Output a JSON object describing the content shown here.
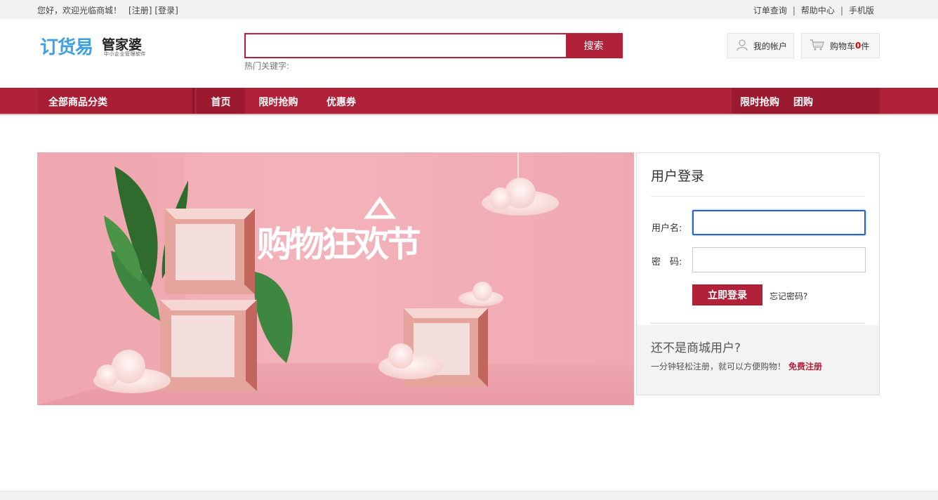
{
  "topbar": {
    "greeting": "您好，欢迎光临商城！",
    "register": "[注册]",
    "login": "[登录]",
    "links": [
      "订单查询",
      "帮助中心",
      "手机版"
    ],
    "separator": "|"
  },
  "logo": {
    "brand": "订货易",
    "brand2": "管家婆",
    "tagline": "中小企业管理软件"
  },
  "search": {
    "value": "",
    "placeholder": "",
    "button": "搜索",
    "hot_label": "热门关键字:"
  },
  "header": {
    "account": "我的帐户",
    "cart_label": "购物车",
    "cart_count": "0",
    "cart_unit": " 件"
  },
  "nav": {
    "all_categories": "全部商品分类",
    "items": [
      "首页",
      "限时抢购",
      "优惠券"
    ],
    "right_items": [
      "限时抢购",
      "团购"
    ]
  },
  "banner": {
    "headline": "购物狂欢节"
  },
  "login_panel": {
    "title": "用户登录",
    "username_label": "用户名:",
    "username_value": "",
    "password_label": "密　码:",
    "password_value": "",
    "submit": "立即登录",
    "forgot": "忘记密码?",
    "register_title": "还不是商城用户?",
    "register_text": "一分钟轻松注册，就可以方便购物！",
    "register_link": "免费注册"
  },
  "colors": {
    "brand_red": "#b0223a",
    "banner_pink": "#eea3ad",
    "logo_blue": "#3ea0e0"
  }
}
